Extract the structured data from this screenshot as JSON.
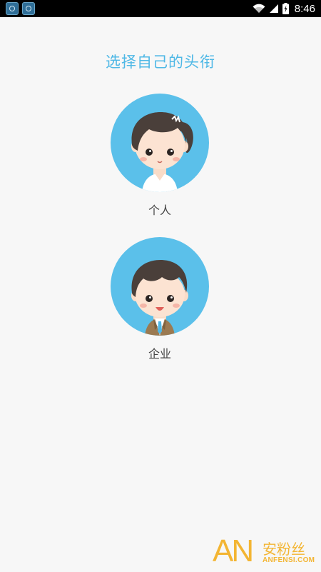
{
  "status_bar": {
    "time": "8:46",
    "notification_icons": [
      "app-notification-icon",
      "app-notification-icon"
    ],
    "system_icons": [
      "wifi-icon",
      "signal-icon",
      "battery-icon"
    ]
  },
  "page": {
    "title": "选择自己的头衔"
  },
  "options": [
    {
      "label": "个人",
      "avatar": "female-avatar-icon"
    },
    {
      "label": "企业",
      "avatar": "male-avatar-icon"
    }
  ],
  "watermark": {
    "logo_text": "AN",
    "cn_text": "安粉丝",
    "en_text": "ANFENSI.COM"
  },
  "colors": {
    "accent": "#4fb8e6",
    "avatar_bg": "#5bc0ea",
    "background": "#f7f7f7",
    "watermark": "#f3b533"
  }
}
